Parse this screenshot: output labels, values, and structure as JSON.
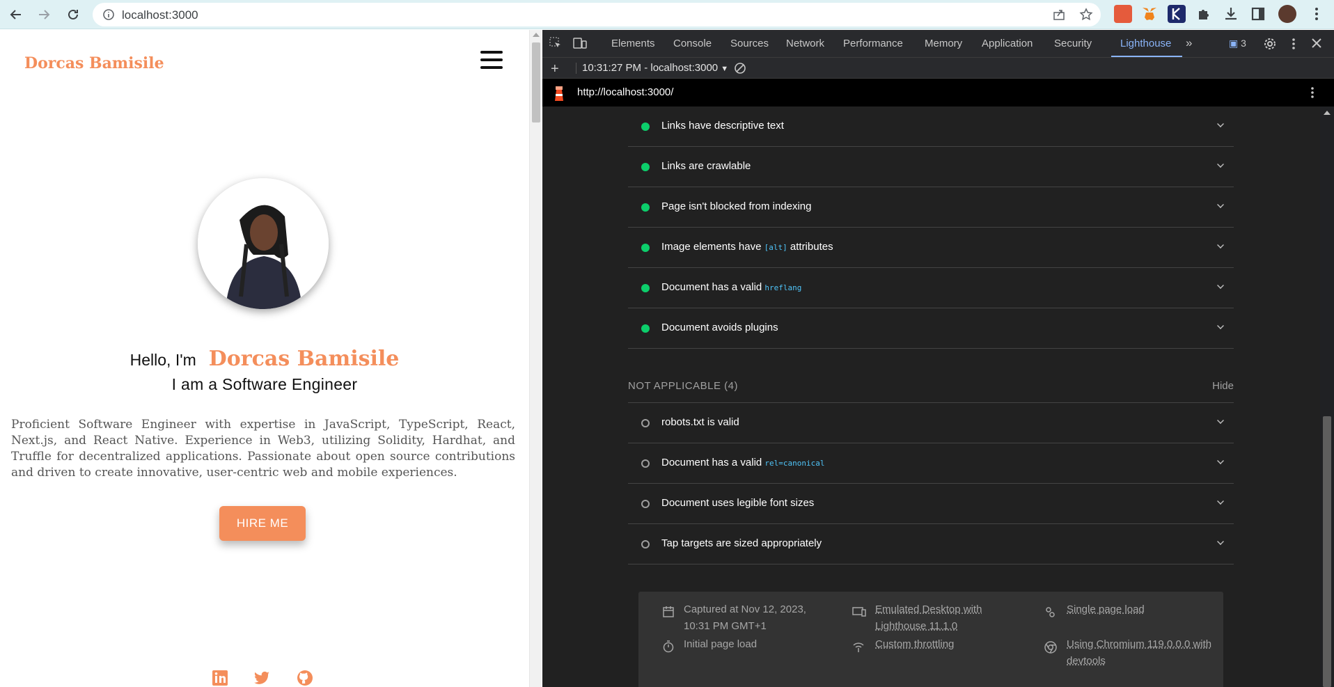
{
  "browser": {
    "url": "localhost:3000",
    "icons": [
      "back-icon",
      "forward-icon",
      "reload-icon",
      "info-icon",
      "share-icon",
      "bookmark-star-icon",
      "extension-icon",
      "puzzle-icon",
      "download-icon",
      "sidepanel-icon",
      "profile-avatar",
      "more-menu-icon"
    ]
  },
  "page": {
    "logo": "Dorcas Bamisile",
    "hello": "Hello, I'm",
    "name": "Dorcas Bamisile",
    "role": "I am a Software Engineer",
    "bio": "Proficient Software Engineer with expertise in JavaScript, TypeScript, React, Next.js, and React Native. Experience in Web3, utilizing Solidity, Hardhat, and Truffle for decentralized applications. Passionate about open source contributions and driven to create innovative, user-centric web and mobile experiences.",
    "cta": "HIRE ME",
    "accent": "#f48e5b"
  },
  "devtools": {
    "tabs": [
      "Elements",
      "Console",
      "Sources",
      "Network",
      "Performance",
      "Memory",
      "Application",
      "Security",
      "Lighthouse"
    ],
    "active_tab": "Lighthouse",
    "issues_count": "3",
    "report_select": "10:31:27 PM - localhost:3000",
    "report_url": "http://localhost:3000/",
    "passed": [
      {
        "text": "Links have descriptive text",
        "code": "",
        "after": ""
      },
      {
        "text": "Links are crawlable",
        "code": "",
        "after": ""
      },
      {
        "text": "Page isn't blocked from indexing",
        "code": "",
        "after": ""
      },
      {
        "text": "Image elements have ",
        "code": "[alt]",
        "after": " attributes"
      },
      {
        "text": "Document has a valid ",
        "code": "hreflang",
        "after": ""
      },
      {
        "text": "Document avoids plugins",
        "code": "",
        "after": ""
      }
    ],
    "not_applicable_title": "NOT APPLICABLE (4)",
    "hide": "Hide",
    "not_applicable": [
      {
        "text": "robots.txt is valid",
        "code": "",
        "after": ""
      },
      {
        "text": "Document has a valid ",
        "code": "rel=canonical",
        "after": ""
      },
      {
        "text": "Document uses legible font sizes",
        "code": "",
        "after": ""
      },
      {
        "text": "Tap targets are sized appropriately",
        "code": "",
        "after": ""
      }
    ],
    "footer": {
      "captured_1": "Captured at Nov 12, 2023,",
      "captured_2": "10:31 PM GMT+1",
      "initial": "Initial page load",
      "emulated_1": "Emulated Desktop with",
      "emulated_2": "Lighthouse 11.1.0",
      "throttling": "Custom throttling",
      "single": "Single page load",
      "chromium_1": "Using Chromium 119.0.0.0 with",
      "chromium_2": "devtools"
    },
    "pass_color": "#0cce6b",
    "code_color": "#4fc3f7"
  }
}
